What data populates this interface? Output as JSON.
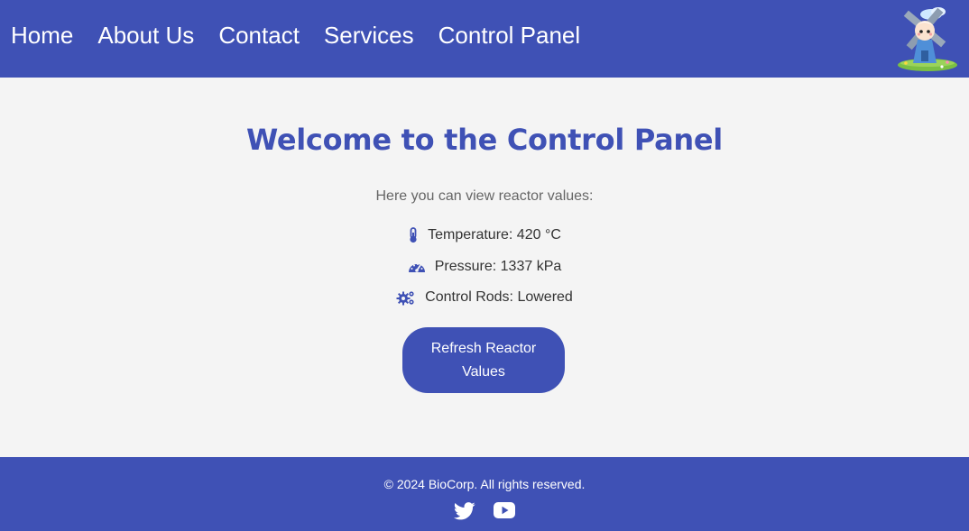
{
  "nav": {
    "items": [
      {
        "label": "Home"
      },
      {
        "label": "About Us"
      },
      {
        "label": "Contact"
      },
      {
        "label": "Services"
      },
      {
        "label": "Control Panel"
      }
    ],
    "logo_icon": "windmill-mascot-logo"
  },
  "main": {
    "title": "Welcome to the Control Panel",
    "intro": "Here you can view reactor values:",
    "readings": {
      "temperature": {
        "icon": "thermometer-icon",
        "label": "Temperature: 420 °C"
      },
      "pressure": {
        "icon": "gauge-icon",
        "label": "Pressure: 1337 kPa"
      },
      "control_rods": {
        "icon": "gears-icon",
        "label": "Control Rods: Lowered"
      }
    },
    "refresh_label": "Refresh Reactor Values"
  },
  "footer": {
    "copyright": "© 2024 BioCorp. All rights reserved.",
    "social": [
      {
        "icon": "twitter-icon"
      },
      {
        "icon": "youtube-icon"
      }
    ]
  },
  "colors": {
    "primary": "#3f51b5",
    "background": "#f4f4f4",
    "text": "#333333",
    "muted_text": "#666666"
  }
}
